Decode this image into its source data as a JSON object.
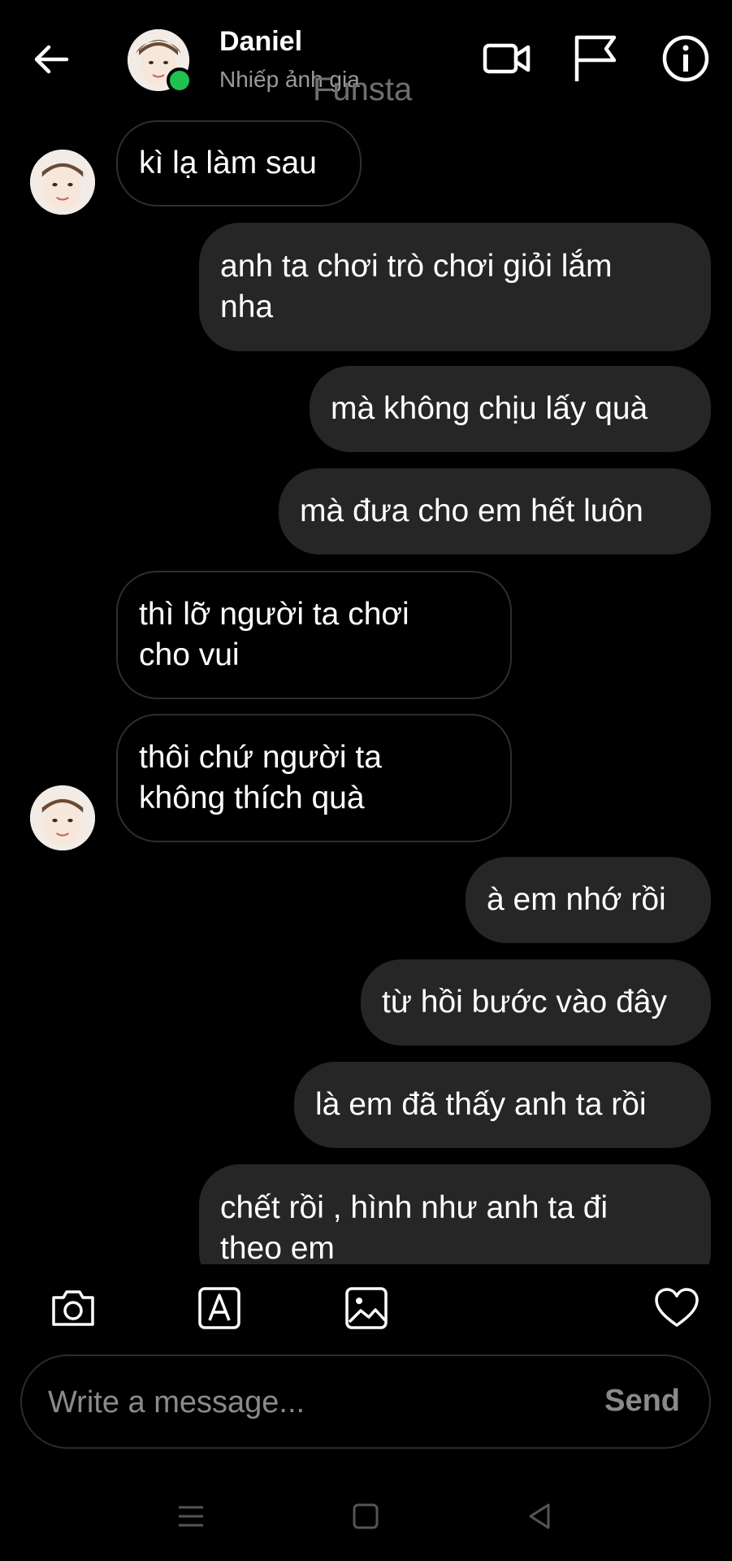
{
  "header": {
    "name": "Daniel",
    "subtitle": "Nhiếp ảnh gia",
    "watermark": "Funsta",
    "back_icon": "arrow-left-icon",
    "icons": [
      "video-call-icon",
      "flag-icon",
      "info-icon"
    ],
    "online_color": "#1fc151"
  },
  "messages": [
    {
      "dir": "in",
      "lines": [
        "kì lạ làm sau"
      ]
    },
    {
      "dir": "out",
      "lines": [
        "anh ta chơi  trò chơi giỏi lắm",
        "nha"
      ]
    },
    {
      "dir": "out",
      "lines": [
        "mà không chịu lấy quà"
      ]
    },
    {
      "dir": "out",
      "lines": [
        "mà đưa cho em hết luôn"
      ]
    },
    {
      "dir": "in",
      "lines": [
        "thì lỡ người ta chơi",
        "cho vui"
      ]
    },
    {
      "dir": "in",
      "lines": [
        "thôi chứ người ta",
        "không thích quà"
      ]
    },
    {
      "dir": "out",
      "lines": [
        "à em nhớ rồi"
      ]
    },
    {
      "dir": "out",
      "lines": [
        "từ hồi bước vào đây"
      ]
    },
    {
      "dir": "out",
      "lines": [
        "là em đã thấy anh ta rồi"
      ]
    },
    {
      "dir": "out",
      "lines": [
        "chết rồi , hình như anh ta đi",
        "theo em"
      ]
    }
  ],
  "toolbar": {
    "icons": [
      "camera-icon",
      "text-style-icon",
      "gallery-icon",
      "heart-icon"
    ]
  },
  "composer": {
    "placeholder": "Write a message...",
    "send_label": "Send"
  },
  "system_nav": [
    "menu-icon",
    "home-icon",
    "back-triangle-icon"
  ],
  "colors": {
    "background": "#000000",
    "outgoing_bubble": "#262626",
    "incoming_border": "#2e2e2e",
    "muted_text": "#8a8a8a"
  }
}
